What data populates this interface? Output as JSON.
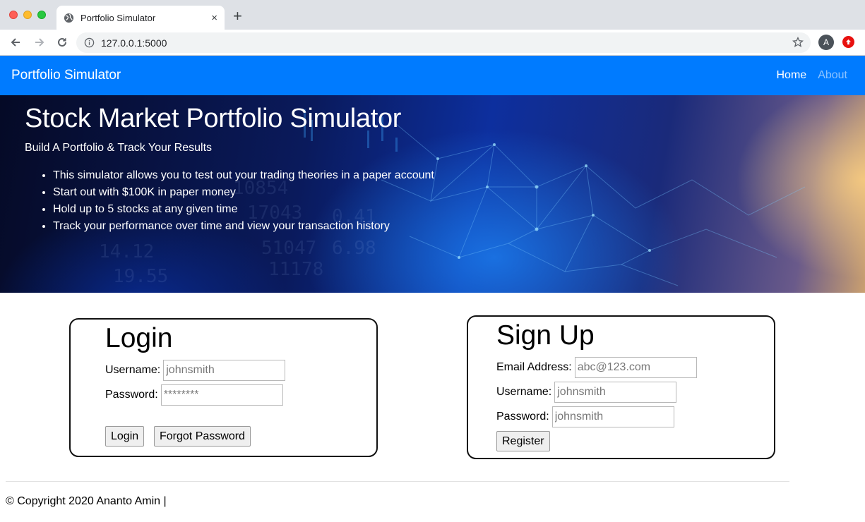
{
  "browser": {
    "tab_title": "Portfolio Simulator",
    "tab_close": "×",
    "new_tab": "+",
    "url": "127.0.0.1:5000",
    "profile_initial": "A"
  },
  "navbar": {
    "brand": "Portfolio Simulator",
    "links": [
      {
        "label": "Home"
      },
      {
        "label": "About"
      }
    ],
    "color": "#007bff"
  },
  "hero": {
    "title": "Stock Market Portfolio Simulator",
    "subtitle": "Build A Portfolio & Track Your Results",
    "bullets": [
      "This simulator allows you to test out your trading theories in a paper account",
      "Start out with $100K in paper money",
      "Hold up to 5 stocks at any given time",
      "Track your performance over time and view your transaction history"
    ]
  },
  "login": {
    "title": "Login",
    "username_label": "Username:",
    "username_placeholder": "johnsmith",
    "password_label": "Password:",
    "password_placeholder": "********",
    "login_button": "Login",
    "forgot_button": "Forgot Password"
  },
  "signup": {
    "title": "Sign Up",
    "email_label": "Email Address:",
    "email_placeholder": "abc@123.com",
    "username_label": "Username:",
    "username_placeholder": "johnsmith",
    "password_label": "Password:",
    "password_placeholder": "johnsmith",
    "register_button": "Register"
  },
  "footer": {
    "text": "© Copyright 2020 Ananto Amin |"
  }
}
